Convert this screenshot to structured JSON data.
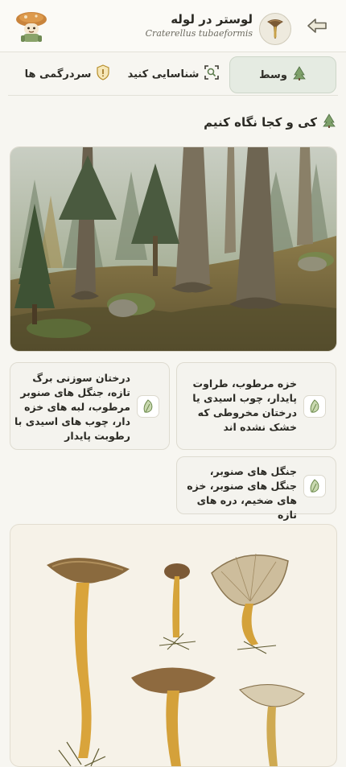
{
  "header": {
    "title": "لوستر در لوله",
    "subtitle": "Craterellus tubaeformis",
    "back_icon": "arrow-left-icon",
    "avatar_icon": "mushroom-mascot-icon",
    "species_icon": "trumpet-mushroom-icon"
  },
  "tabs": [
    {
      "label": "وسط",
      "icon": "tree-icon",
      "active": true
    },
    {
      "label": "شناسایی کنید",
      "icon": "scan-icon",
      "active": false
    },
    {
      "label": "سردرگمی ها",
      "icon": "warning-shield-icon",
      "active": false
    }
  ],
  "section": {
    "title": "کی و کجا نگاه کنیم",
    "icon": "tree-icon"
  },
  "habitat_cards": [
    {
      "text": "خزه مرطوب، طراوت پایدار، چوب اسیدی یا درختان مخروطی که خشک نشده اند",
      "icon": "leaf-icon"
    },
    {
      "text": "درختان سوزنی برگ تازه، جنگل های صنوبر مرطوب، لبه های خزه دار، چوب های اسیدی با رطوبت پایدار",
      "icon": "leaf-icon"
    },
    {
      "text": "جنگل های صنوبر، جنگل های صنوبر، خزه های ضخیم، دره های تازه",
      "icon": "leaf-icon"
    }
  ],
  "colors": {
    "accent": "#e5ebe2",
    "background": "#f7f6f1",
    "text": "#2b2a24"
  }
}
